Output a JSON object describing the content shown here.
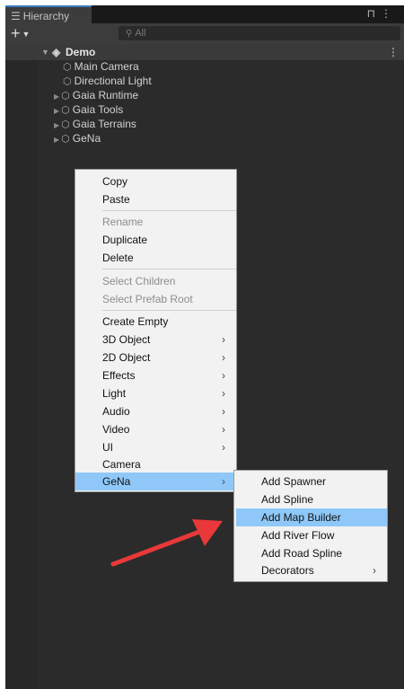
{
  "tab": {
    "icon": "hierarchy-list-icon",
    "title": "Hierarchy"
  },
  "toolbar": {
    "add": "+",
    "search_placeholder": "All"
  },
  "scene": {
    "name": "Demo"
  },
  "tree": [
    {
      "label": "Main Camera",
      "expandable": false
    },
    {
      "label": "Directional Light",
      "expandable": false
    },
    {
      "label": "Gaia Runtime",
      "expandable": true
    },
    {
      "label": "Gaia Tools",
      "expandable": true
    },
    {
      "label": "Gaia Terrains",
      "expandable": true
    },
    {
      "label": "GeNa",
      "expandable": true
    }
  ],
  "context_menu": {
    "items": [
      {
        "label": "Copy",
        "disabled": false
      },
      {
        "label": "Paste",
        "disabled": false
      },
      {
        "label": "Rename",
        "disabled": true
      },
      {
        "label": "Duplicate",
        "disabled": false
      },
      {
        "label": "Delete",
        "disabled": false
      },
      {
        "label": "Select Children",
        "disabled": true
      },
      {
        "label": "Select Prefab Root",
        "disabled": true
      },
      {
        "label": "Create Empty",
        "disabled": false
      },
      {
        "label": "3D Object",
        "submenu": true
      },
      {
        "label": "2D Object",
        "submenu": true
      },
      {
        "label": "Effects",
        "submenu": true
      },
      {
        "label": "Light",
        "submenu": true
      },
      {
        "label": "Audio",
        "submenu": true
      },
      {
        "label": "Video",
        "submenu": true
      },
      {
        "label": "UI",
        "submenu": true
      },
      {
        "label": "Camera",
        "disabled": false
      },
      {
        "label": "GeNa",
        "submenu": true,
        "highlighted": true
      }
    ]
  },
  "submenu": {
    "items": [
      {
        "label": "Add Spawner"
      },
      {
        "label": "Add Spline"
      },
      {
        "label": "Add Map Builder",
        "highlighted": true
      },
      {
        "label": "Add River Flow"
      },
      {
        "label": "Add Road Spline"
      },
      {
        "label": "Decorators",
        "submenu": true
      }
    ]
  },
  "colors": {
    "highlight": "#8fc8f8",
    "annotation_arrow": "#e8383a",
    "panel": "#2b2b2b"
  }
}
